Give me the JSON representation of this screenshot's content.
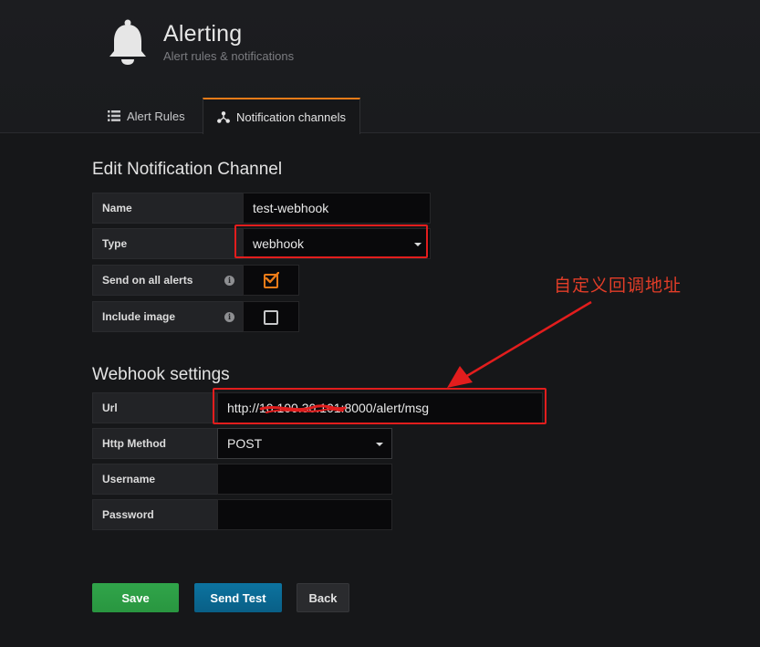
{
  "header": {
    "title": "Alerting",
    "subtitle": "Alert rules & notifications",
    "icon": "bell-icon"
  },
  "tabs": [
    {
      "label": "Alert Rules",
      "icon": "list-icon",
      "active": false
    },
    {
      "label": "Notification channels",
      "icon": "share-nodes-icon",
      "active": true
    }
  ],
  "form": {
    "heading": "Edit Notification Channel",
    "name_label": "Name",
    "name_value": "test-webhook",
    "type_label": "Type",
    "type_value": "webhook",
    "send_all_label": "Send on all alerts",
    "send_all_checked": true,
    "include_image_label": "Include image",
    "include_image_checked": false
  },
  "webhook": {
    "heading": "Webhook settings",
    "url_label": "Url",
    "url_value": "http://10.100.30.101:8000/alert/msg",
    "method_label": "Http Method",
    "method_value": "POST",
    "username_label": "Username",
    "username_value": "",
    "password_label": "Password",
    "password_value": ""
  },
  "annotation": {
    "text": "自定义回调地址",
    "color": "#e21d1d"
  },
  "buttons": {
    "save": "Save",
    "send_test": "Send Test",
    "back": "Back"
  },
  "colors": {
    "accent": "#eb7b18",
    "save": "#299640",
    "send_test": "#0b6b94"
  }
}
